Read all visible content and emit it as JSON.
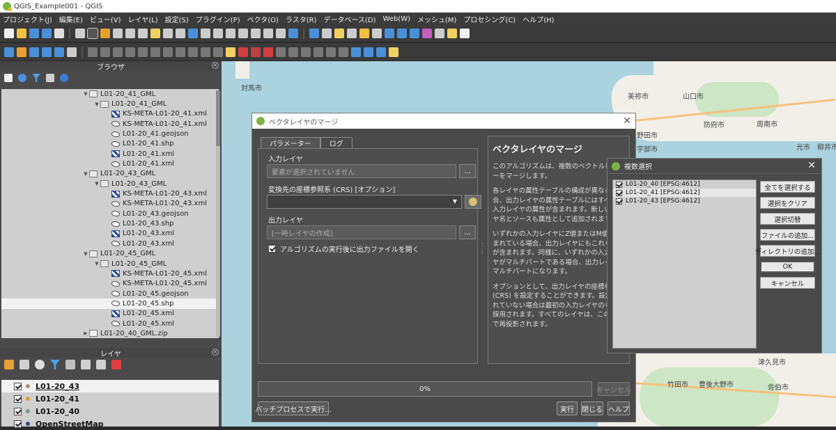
{
  "window": {
    "title": "QGIS_Example001 - QGIS"
  },
  "menu": [
    "プロジェクト(J)",
    "編集(E)",
    "ビュー(V)",
    "レイヤ(L)",
    "設定(S)",
    "プラグイン(P)",
    "ベクタ(O)",
    "ラスタ(R)",
    "データベース(D)",
    "Web(W)",
    "メッシュ(M)",
    "プロセシング(C)",
    "ヘルプ(H)"
  ],
  "browser_panel": {
    "title": "ブラウザ",
    "tree": [
      {
        "label": "L01-20_41_GML",
        "type": "folder",
        "level": 0
      },
      {
        "label": "L01-20_41_GML",
        "type": "folder",
        "level": 1
      },
      {
        "label": "KS-META-L01-20_41.xml",
        "type": "xml",
        "level": 2
      },
      {
        "label": "KS-META-L01-20_41.xml",
        "type": "shp",
        "level": 2
      },
      {
        "label": "L01-20_41.geojson",
        "type": "shp",
        "level": 2
      },
      {
        "label": "L01-20_41.shp",
        "type": "shp",
        "level": 2
      },
      {
        "label": "L01-20_41.xml",
        "type": "xml",
        "level": 2
      },
      {
        "label": "L01-20_41.xml",
        "type": "shp",
        "level": 2
      },
      {
        "label": "L01-20_43_GML",
        "type": "folder",
        "level": 0
      },
      {
        "label": "L01-20_43_GML",
        "type": "folder",
        "level": 1
      },
      {
        "label": "KS-META-L01-20_43.xml",
        "type": "xml",
        "level": 2
      },
      {
        "label": "KS-META-L01-20_43.xml",
        "type": "shp",
        "level": 2
      },
      {
        "label": "L01-20_43.geojson",
        "type": "shp",
        "level": 2
      },
      {
        "label": "L01-20_43.shp",
        "type": "shp",
        "level": 2
      },
      {
        "label": "L01-20_43.xml",
        "type": "xml",
        "level": 2
      },
      {
        "label": "L01-20_43.xml",
        "type": "shp",
        "level": 2
      },
      {
        "label": "L01-20_45_GML",
        "type": "folder",
        "level": 0
      },
      {
        "label": "L01-20_45_GML",
        "type": "folder",
        "level": 1
      },
      {
        "label": "KS-META-L01-20_45.xml",
        "type": "xml",
        "level": 2
      },
      {
        "label": "KS-META-L01-20_45.xml",
        "type": "shp",
        "level": 2
      },
      {
        "label": "L01-20_45.geojson",
        "type": "shp",
        "level": 2
      },
      {
        "label": "L01-20_45.shp",
        "type": "shp",
        "level": 2,
        "selected": true
      },
      {
        "label": "L01-20_45.xml",
        "type": "xml",
        "level": 2
      },
      {
        "label": "L01-20_45.xml",
        "type": "shp",
        "level": 2
      },
      {
        "label": "L01-20_40_GML.zip",
        "type": "zip",
        "level": 0
      }
    ]
  },
  "layers_panel": {
    "title": "レイヤ",
    "layers": [
      {
        "name": "L01-20_43",
        "dot": "#b0906a",
        "checked": true,
        "highlight": true
      },
      {
        "name": "L01-20_41",
        "dot": "#e0a020",
        "checked": true
      },
      {
        "name": "L01-20_40",
        "dot": "#7a9a7a",
        "checked": true
      },
      {
        "name": "OpenStreetMap",
        "dot": "#2a4c8a",
        "checked": true
      }
    ]
  },
  "map_labels": [
    "対馬市",
    "美祢市",
    "山口市",
    "防府市",
    "周南市",
    "光市",
    "柳井市",
    "宇部市",
    "野田市",
    "津久見市",
    "竹田市",
    "豊後大野市",
    "佐伯市"
  ],
  "merge_dialog": {
    "title": "ベクタレイヤのマージ",
    "tabs": [
      "パラメーター",
      "ログ"
    ],
    "input_label": "入力レイヤ",
    "input_value": "要素が選択されていません",
    "crs_label": "変換先の座標参照系 (CRS) [オプション]",
    "output_label": "出力レイヤ",
    "output_value": "[一時レイヤの作成]",
    "open_output_label": "アルゴリズムの実行後に出力ファイルを開く",
    "browse_label": "...",
    "help_title": "ベクタレイヤのマージ",
    "help_paragraphs": [
      "このアルゴリズムは、複数のベクトルレイヤーをマージします。",
      "各レイヤの属性テーブルの構成が異なる場合、出力レイヤの属性テーブルにはすべての入力レイヤの属性が含まれます。新しいレイヤ名とソースも属性として追加されます。",
      "いずれかの入力レイヤにZ値またはM値が含まれている場合、出力レイヤにもこれらの値が含まれます。同様に、いずれかの入力レイヤがマルチパートである場合、出力レイヤもマルチパートになります。",
      "オプションとして、出力レイヤの座標参照系 (CRS) を設定することができます。設定されていない場合は最初の入力レイヤのものが採用されます。すべてのレイヤは、このCRSで再投影されます。"
    ],
    "progress_text": "0%",
    "cancel_label": "キャンセル",
    "batch_label": "バッチプロセスで実行...",
    "run_label": "実行",
    "close_label": "閉じる",
    "help_label": "ヘルプ"
  },
  "multi_select_dialog": {
    "title": "複数選択",
    "items": [
      {
        "label": "L01-20_40 [EPSG:4612]",
        "checked": true
      },
      {
        "label": "L01-20_41 [EPSG:4612]",
        "checked": true,
        "highlight": true
      },
      {
        "label": "L01-20_43 [EPSG:4612]",
        "checked": true
      }
    ],
    "buttons": [
      "全てを選択する",
      "選択をクリア",
      "選択切替",
      "ファイルの追加...",
      "ディレクトリの追加...",
      "OK",
      "キャンセル"
    ]
  },
  "colors": {
    "map_water": "#aad3df",
    "map_land": "#f2efe9",
    "qgis_green": "#7cb342",
    "dark_bg": "#4a4a4a"
  }
}
